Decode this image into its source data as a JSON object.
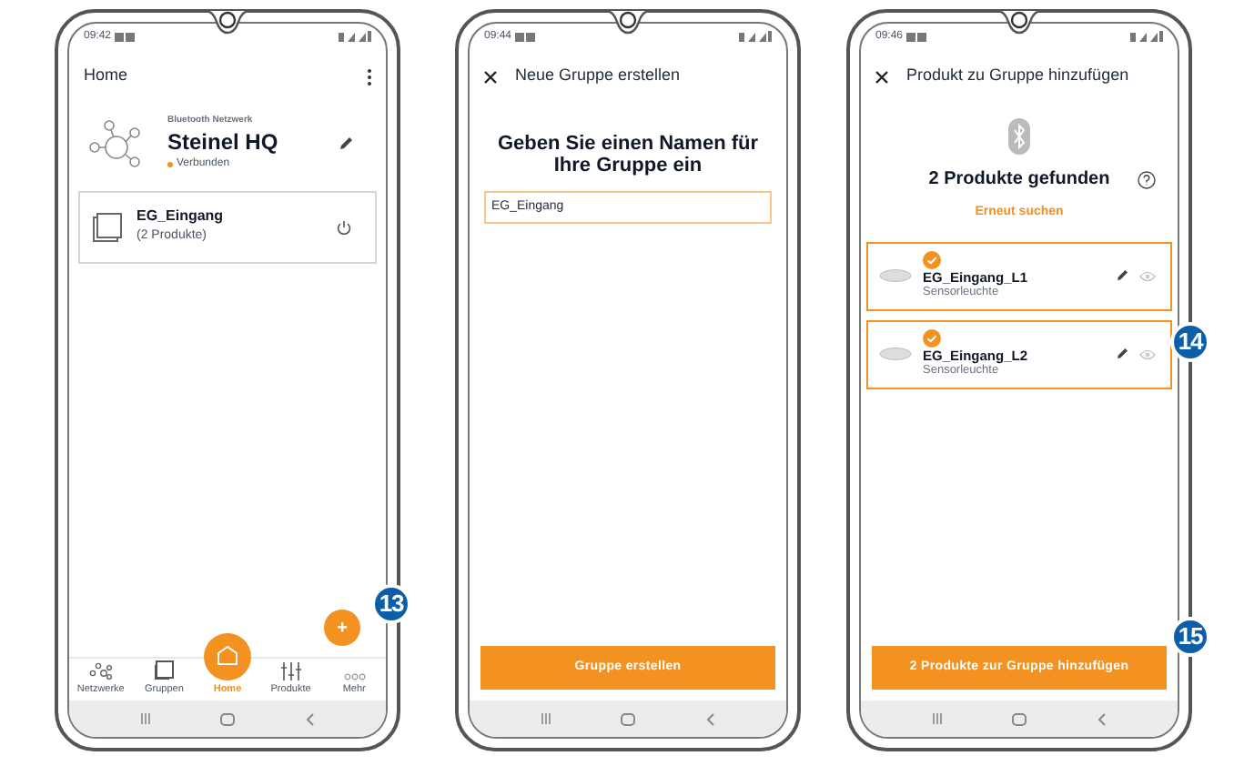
{
  "phones": [
    {
      "kind": "home",
      "status_time": "09:42",
      "title": "Home",
      "callout": "13",
      "network": {
        "caption": "Bluetooth Netzwerk",
        "name": "Steinel HQ",
        "status": "Verbunden"
      },
      "groups": [
        {
          "name": "EG_Eingang",
          "count": "(2 Produkte)"
        }
      ],
      "fab": "+",
      "nav": [
        {
          "label": "Netzwerke",
          "selected": false
        },
        {
          "label": "Gruppen",
          "selected": false
        },
        {
          "label": "Home",
          "selected": true
        },
        {
          "label": "Produkte",
          "selected": false
        },
        {
          "label": "Mehr",
          "selected": false
        }
      ]
    },
    {
      "kind": "create_group",
      "status_time": "09:44",
      "title": "Neue Gruppe erstellen",
      "prompt": "Geben Sie einen Namen für Ihre Gruppe ein",
      "field_value": "EG_Eingang",
      "button": "Gruppe erstellen"
    },
    {
      "kind": "add_products",
      "status_time": "09:46",
      "title": "Produkt zu Gruppe hinzufügen",
      "heading": "2 Produkte gefunden",
      "link": "Erneut suchen",
      "list_callout": "14",
      "button_callout": "15",
      "products": [
        {
          "name": "EG_Eingang_L1",
          "type": "Sensorleuchte",
          "checked": true
        },
        {
          "name": "EG_Eingang_L2",
          "type": "Sensorleuchte",
          "checked": true
        }
      ],
      "button": "2 Produkte zur Gruppe hinzufügen"
    }
  ]
}
